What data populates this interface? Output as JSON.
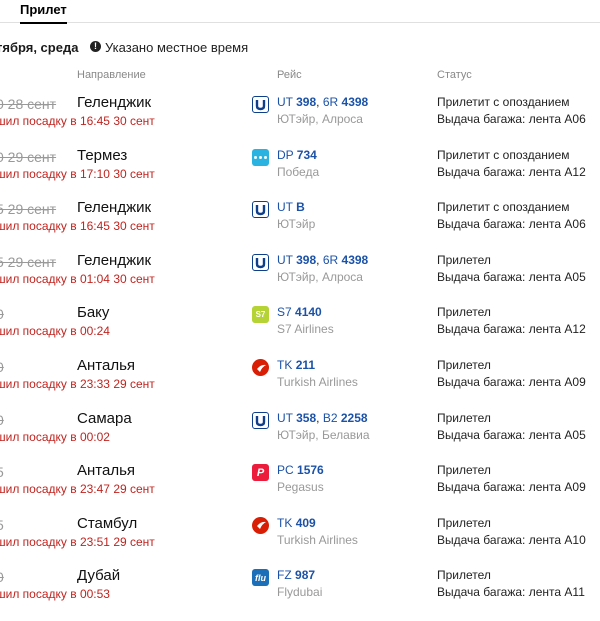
{
  "tabs": {
    "active": "Прилет"
  },
  "date_header": {
    "date": "тября, среда",
    "note": "Указано местное время"
  },
  "columns": {
    "direction": "Направление",
    "flight": "Рейс",
    "status": "Статус"
  },
  "rows": [
    {
      "time": "0 28 сент",
      "strike": true,
      "city": "Геленджик",
      "landed": "шил посадку в 16:45",
      "landed_date": "30 сент",
      "logo": "ut-icon",
      "flights": [
        {
          "code": "UT",
          "num": "398"
        },
        {
          "code": "6R",
          "num": "4398"
        }
      ],
      "airline": "ЮТэйр, Алроса",
      "status": "Прилетит с опозданием",
      "baggage": "Выдача багажа: лента А06"
    },
    {
      "time": "0 29 сент",
      "strike": true,
      "city": "Термез",
      "landed": "шил посадку в 17:10",
      "landed_date": "30 сент",
      "logo": "dp-icon",
      "flights": [
        {
          "code": "DP",
          "num": "734"
        }
      ],
      "airline": "Победа",
      "status": "Прилетит с опозданием",
      "baggage": "Выдача багажа: лента А12"
    },
    {
      "time": "5 29 сент",
      "strike": true,
      "city": "Геленджик",
      "landed": "шил посадку в 16:45",
      "landed_date": "30 сент",
      "logo": "ut-icon",
      "flights": [
        {
          "code": "UT",
          "num": "В"
        }
      ],
      "airline": "ЮТэйр",
      "status": "Прилетит с опозданием",
      "baggage": "Выдача багажа: лента А06"
    },
    {
      "time": "5 29 сент",
      "strike": true,
      "city": "Геленджик",
      "landed": "шил посадку в 01:04",
      "landed_date": "30 сент",
      "logo": "ut-icon",
      "flights": [
        {
          "code": "UT",
          "num": "398"
        },
        {
          "code": "6R",
          "num": "4398"
        }
      ],
      "airline": "ЮТэйр, Алроса",
      "status": "Прилетел",
      "baggage": "Выдача багажа: лента А05"
    },
    {
      "time": "0",
      "strike": true,
      "city": "Баку",
      "landed": "шил посадку в 00:24",
      "landed_date": "",
      "logo": "s7-icon",
      "flights": [
        {
          "code": "S7",
          "num": "4140"
        }
      ],
      "airline": "S7 Airlines",
      "status": "Прилетел",
      "baggage": "Выдача багажа: лента А12"
    },
    {
      "time": "0",
      "strike": true,
      "city": "Анталья",
      "landed": "шил посадку в 23:33",
      "landed_date": "29 сент",
      "logo": "tk-icon",
      "flights": [
        {
          "code": "TK",
          "num": "211"
        }
      ],
      "airline": "Turkish Airlines",
      "status": "Прилетел",
      "baggage": "Выдача багажа: лента А09"
    },
    {
      "time": "0",
      "strike": true,
      "city": "Самара",
      "landed": "шил посадку в 00:02",
      "landed_date": "",
      "logo": "ut-icon",
      "flights": [
        {
          "code": "UT",
          "num": "358"
        },
        {
          "code": "B2",
          "num": "2258"
        }
      ],
      "airline": "ЮТэйр, Белавиа",
      "status": "Прилетел",
      "baggage": "Выдача багажа: лента А05"
    },
    {
      "time": "5",
      "strike": false,
      "city": "Анталья",
      "landed": "шил посадку в 23:47",
      "landed_date": "29 сент",
      "logo": "pc-icon",
      "flights": [
        {
          "code": "PC",
          "num": "1576"
        }
      ],
      "airline": "Pegasus",
      "status": "Прилетел",
      "baggage": "Выдача багажа: лента А09"
    },
    {
      "time": "5",
      "strike": false,
      "city": "Стамбул",
      "landed": "шил посадку в 23:51",
      "landed_date": "29 сент",
      "logo": "tk-icon",
      "flights": [
        {
          "code": "TK",
          "num": "409"
        }
      ],
      "airline": "Turkish Airlines",
      "status": "Прилетел",
      "baggage": "Выдача багажа: лента А10"
    },
    {
      "time": "0",
      "strike": true,
      "city": "Дубай",
      "landed": "шил посадку в 00:53",
      "landed_date": "",
      "logo": "fz-icon",
      "flights": [
        {
          "code": "FZ",
          "num": "987"
        }
      ],
      "airline": "Flydubai",
      "status": "Прилетел",
      "baggage": "Выдача багажа: лента А11"
    }
  ]
}
